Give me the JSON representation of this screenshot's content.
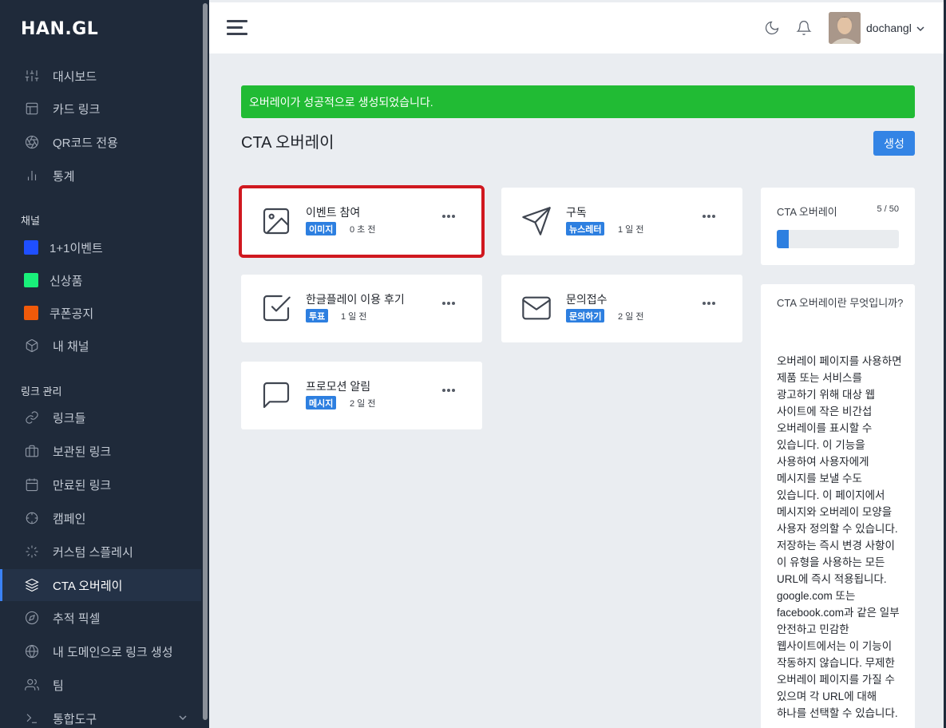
{
  "brand": {
    "logo": "HAN.GL"
  },
  "sidebar": {
    "main_items": [
      {
        "label": "대시보드",
        "icon": "sliders-icon"
      },
      {
        "label": "카드 링크",
        "icon": "layout-icon"
      },
      {
        "label": "QR코드 전용",
        "icon": "aperture-icon"
      },
      {
        "label": "통계",
        "icon": "bar-chart-icon"
      }
    ],
    "channels_title": "채널",
    "channels": [
      {
        "label": "1+1이벤트",
        "color": "#1f4fff"
      },
      {
        "label": "신상품",
        "color": "#19f07a"
      },
      {
        "label": "쿠폰공지",
        "color": "#f05a0a"
      }
    ],
    "my_channel": "내 채널",
    "links_title": "링크 관리",
    "link_items": [
      {
        "label": "링크들",
        "icon": "link-icon"
      },
      {
        "label": "보관된 링크",
        "icon": "briefcase-icon"
      },
      {
        "label": "만료된 링크",
        "icon": "calendar-icon"
      },
      {
        "label": "캠페인",
        "icon": "crosshair-icon"
      },
      {
        "label": "커스텀 스플레시",
        "icon": "loader-icon"
      },
      {
        "label": "CTA 오버레이",
        "icon": "layers-icon",
        "active": true
      },
      {
        "label": "추적 픽셀",
        "icon": "compass-icon"
      },
      {
        "label": "내 도메인으로 링크 생성",
        "icon": "globe-icon"
      },
      {
        "label": "팀",
        "icon": "users-icon"
      },
      {
        "label": "통합도구",
        "icon": "terminal-icon"
      }
    ]
  },
  "topbar": {
    "username": "dochangl"
  },
  "alert": {
    "message": "오버레이가 성공적으로 생성되었습니다."
  },
  "page": {
    "title": "CTA 오버레이",
    "create_label": "생성"
  },
  "overlays": [
    {
      "title": "이벤트 참여",
      "type": "이미지",
      "time": "0 초 전",
      "icon": "image-icon"
    },
    {
      "title": "구독",
      "type": "뉴스레터",
      "time": "1 일 전",
      "icon": "send-icon"
    },
    {
      "title": "한글플레이 이용 후기",
      "type": "투표",
      "time": "1 일 전",
      "icon": "check-square-icon"
    },
    {
      "title": "문의접수",
      "type": "문의하기",
      "time": "2 일 전",
      "icon": "mail-icon"
    },
    {
      "title": "프로모션 알림",
      "type": "메시지",
      "time": "2 일 전",
      "icon": "message-square-icon"
    }
  ],
  "quota": {
    "label": "CTA 오버레이",
    "count": "5 / 50",
    "used": 5,
    "limit": 50
  },
  "info": {
    "title": "CTA 오버레이란 무엇입니까?",
    "body": "오버레이 페이지를 사용하면 제품 또는 서비스를 광고하기 위해 대상 웹 사이트에 작은 비간섭 오버레이를 표시할 수 있습니다. 이 기능을 사용하여 사용자에게 메시지를 보낼 수도 있습니다. 이 페이지에서 메시지와 오버레이 모양을 사용자 정의할 수 있습니다. 저장하는 즉시 변경 사항이 이 유형을 사용하는 모든 URL에 즉시 적용됩니다. google.com 또는 facebook.com과 같은 일부 안전하고 민감한 웹사이트에서는 이 기능이 작동하지 않습니다. 무제한 오버레이 페이지를 가질 수 있으며 각 URL에 대해 하나를 선택할 수 있습니다."
  }
}
